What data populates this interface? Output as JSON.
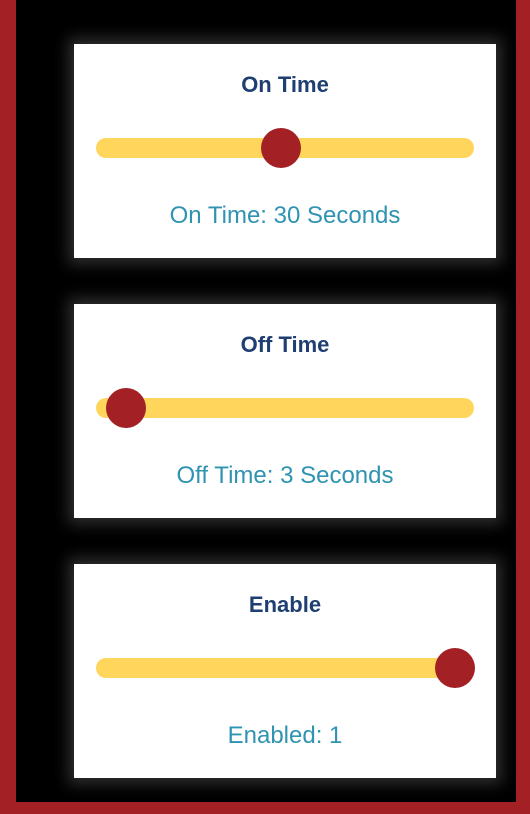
{
  "colors": {
    "outer_frame": "#a32024",
    "background": "#000000",
    "card": "#ffffff",
    "title_text": "#1f3f72",
    "status_text": "#2f93b2",
    "track": "#ffd55c",
    "thumb": "#a32024"
  },
  "cards": [
    {
      "title": "On Time",
      "status": "On Time: 30 Seconds",
      "slider_fraction": 0.49
    },
    {
      "title": "Off Time",
      "status": "Off Time: 3 Seconds",
      "slider_fraction": 0.08
    },
    {
      "title": "Enable",
      "status": "Enabled: 1",
      "slider_fraction": 0.95
    }
  ]
}
